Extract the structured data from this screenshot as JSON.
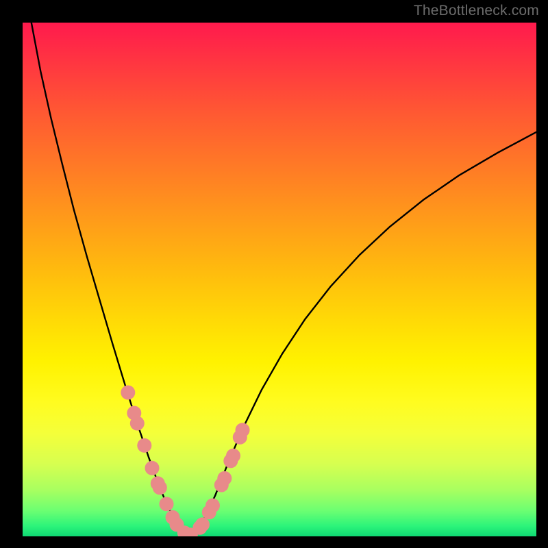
{
  "watermark": {
    "text": "TheBottleneck.com"
  },
  "colors": {
    "frame": "#000000",
    "curve_stroke": "#000000",
    "marker_fill": "#e88a8a",
    "marker_stroke": "#d07070"
  },
  "chart_data": {
    "type": "line",
    "title": "",
    "xlabel": "",
    "ylabel": "",
    "xlim_frac": [
      0.0,
      1.0
    ],
    "ylim_frac": [
      0.0,
      1.0
    ],
    "note": "Axis tick labels are not rendered; coordinates below are fractions of the 750×750 plot area (x from left, y from top).",
    "series": [
      {
        "name": "bottleneck-curve",
        "x_frac": [
          0.017,
          0.035,
          0.055,
          0.077,
          0.1,
          0.125,
          0.15,
          0.175,
          0.2,
          0.223,
          0.245,
          0.265,
          0.283,
          0.3,
          0.313,
          0.325,
          0.337,
          0.35,
          0.375,
          0.4,
          0.43,
          0.465,
          0.505,
          0.55,
          0.6,
          0.655,
          0.715,
          0.78,
          0.85,
          0.925,
          1.0
        ],
        "y_frac": [
          0.0,
          0.095,
          0.185,
          0.275,
          0.365,
          0.455,
          0.54,
          0.625,
          0.707,
          0.78,
          0.845,
          0.9,
          0.943,
          0.973,
          0.99,
          0.997,
          0.99,
          0.973,
          0.92,
          0.857,
          0.787,
          0.715,
          0.645,
          0.577,
          0.513,
          0.453,
          0.397,
          0.345,
          0.297,
          0.253,
          0.213
        ]
      }
    ],
    "markers": {
      "name": "highlighted-points",
      "x_frac": [
        0.205,
        0.217,
        0.223,
        0.237,
        0.252,
        0.263,
        0.267,
        0.28,
        0.292,
        0.3,
        0.315,
        0.327,
        0.345,
        0.35,
        0.363,
        0.37,
        0.387,
        0.393,
        0.405,
        0.41,
        0.423,
        0.428
      ],
      "y_frac": [
        0.72,
        0.76,
        0.78,
        0.823,
        0.867,
        0.897,
        0.905,
        0.937,
        0.963,
        0.977,
        0.993,
        0.997,
        0.983,
        0.977,
        0.953,
        0.94,
        0.9,
        0.887,
        0.853,
        0.843,
        0.807,
        0.793
      ]
    }
  }
}
